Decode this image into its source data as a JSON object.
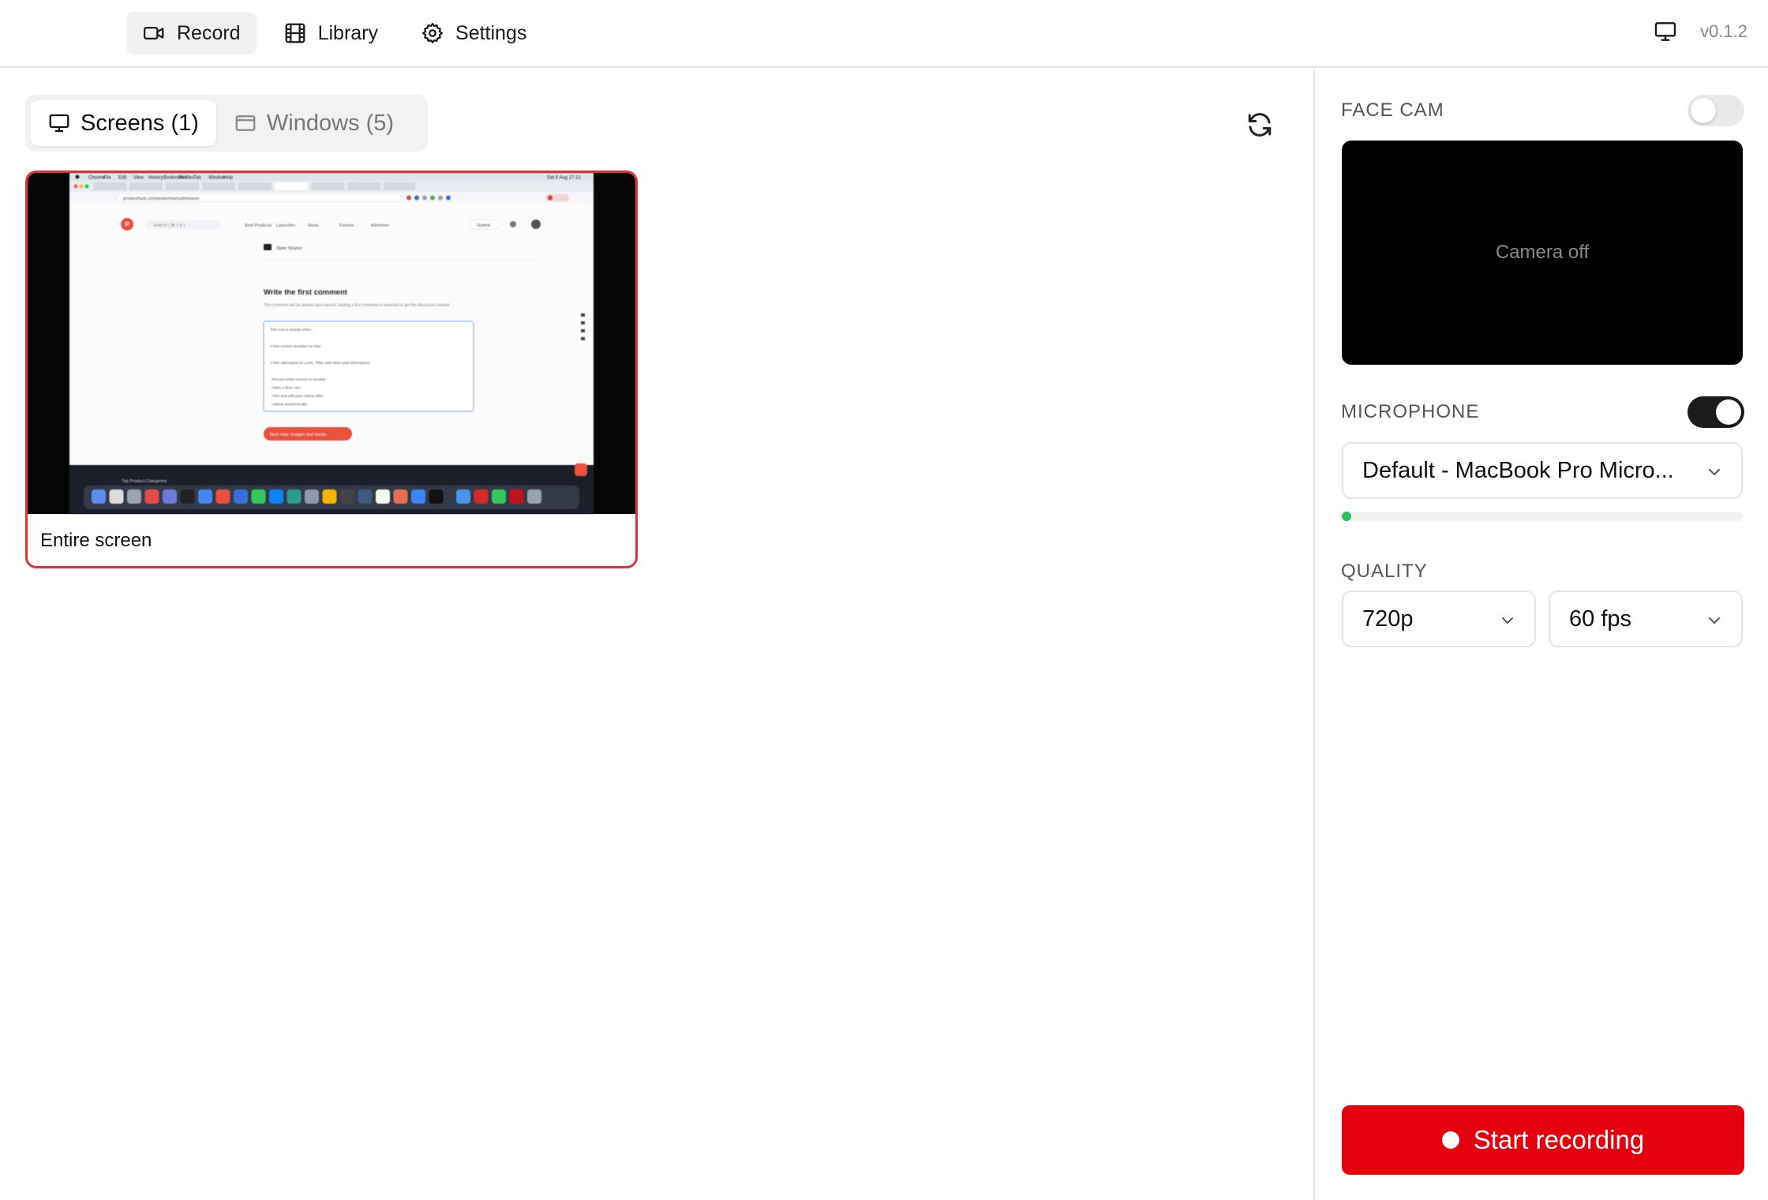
{
  "nav": {
    "record": "Record",
    "library": "Library",
    "settings": "Settings"
  },
  "version": "v0.1.2",
  "source_tabs": {
    "screens": "Screens (1)",
    "windows": "Windows (5)"
  },
  "screen_card": {
    "label": "Entire screen"
  },
  "preview": {
    "menu": [
      "Chrome",
      "File",
      "Edit",
      "View",
      "History",
      "Bookmarks",
      "Profiles",
      "Tab",
      "Window",
      "Help"
    ],
    "clock": "Sat 9 Aug  17:12",
    "url": "producthunt.com/posts/new/submission",
    "search": "Search ( ⌘ + k )",
    "site_nav": [
      "Best Products",
      "Launches",
      "News",
      "Forums",
      "Advertise"
    ],
    "submit": "Submit",
    "tag": "Open Source",
    "heading": "Write the first comment",
    "subheading": "This comment will be posted upon launch. Adding a first comment is essential to get the discussion started.",
    "comment_lines": [
      "This tool is exactly what I",
      "",
      "A free screen recorder for Mac",
      "",
      "A free alternative to Loom, Tella, and other paid alternatives.",
      "",
      "- Record entire screen or window",
      "- Have a face cam",
      "- Trim and edit your videos after",
      "- Videos stored locally"
    ],
    "next_button": "Next step: Images and media",
    "footer": "Top Product Categories"
  },
  "panel": {
    "face_cam_label": "FACE CAM",
    "face_cam_enabled": false,
    "camera_status": "Camera off",
    "microphone_label": "MICROPHONE",
    "microphone_enabled": true,
    "microphone_device": "Default - MacBook Pro Micro...",
    "mic_level": 0.02,
    "quality_label": "QUALITY",
    "resolution": "720p",
    "fps": "60 fps",
    "start_button": "Start recording"
  },
  "colors": {
    "accent": "#e5000e",
    "selected_border": "#e5303a",
    "meter": "#2fbf5f"
  }
}
